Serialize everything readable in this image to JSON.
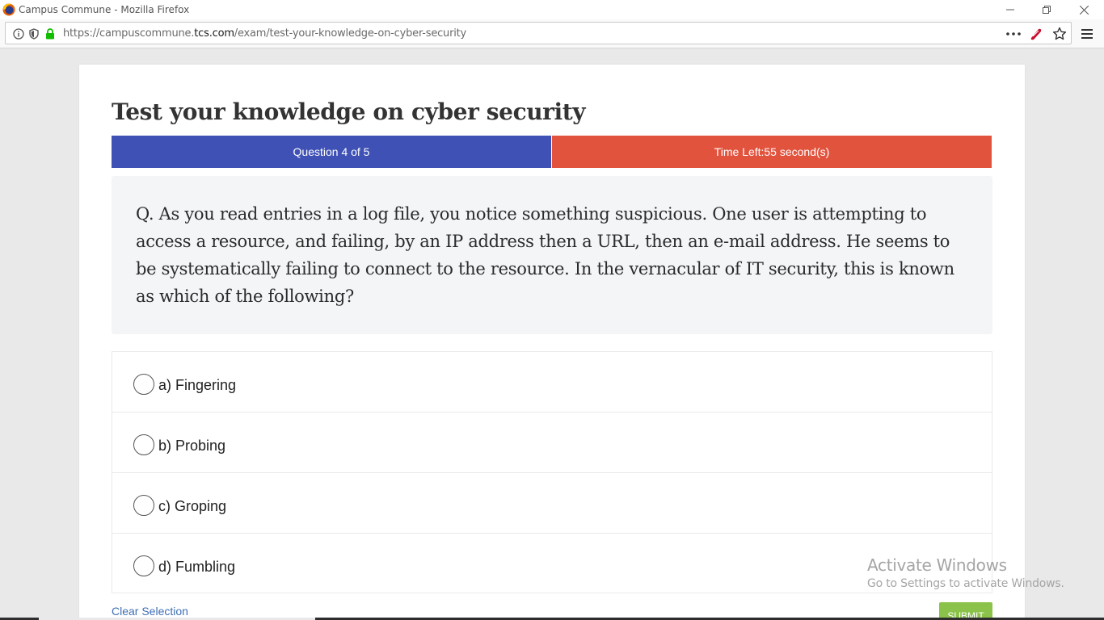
{
  "browser": {
    "window_title": "Campus Commune - Mozilla Firefox",
    "url_prefix": "https://campuscommune.",
    "url_domain": "tcs.com",
    "url_path": "/exam/test-your-knowledge-on-cyber-security"
  },
  "exam": {
    "title": "Test your knowledge on cyber security",
    "question_counter": "Question 4 of 5",
    "time_left": "Time Left:55 second(s)",
    "question_text": "Q. As you read entries in a log file, you notice something suspicious. One user is attempting to access a resource, and failing, by an IP address then a URL, then an e-mail address. He seems to be systematically failing to connect to the resource. In the vernacular of IT security, this is known as which of the following?",
    "options": [
      {
        "label": "a) Fingering",
        "selected": false
      },
      {
        "label": "b) Probing",
        "selected": false
      },
      {
        "label": "c) Groping",
        "selected": false
      },
      {
        "label": "d) Fumbling",
        "selected": false
      }
    ],
    "clear_selection_label": "Clear Selection",
    "submit_label": "SUBMIT"
  },
  "watermark": {
    "line1": "Activate Windows",
    "line2": "Go to Settings to activate Windows."
  },
  "colors": {
    "counter_bg": "#3f51b5",
    "timer_bg": "#e2533e",
    "submit_bg": "#8bc34a",
    "link": "#3f6fb5"
  }
}
